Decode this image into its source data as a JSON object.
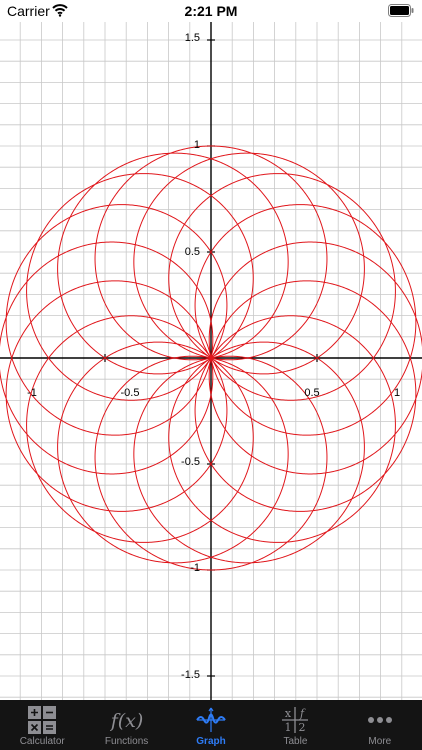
{
  "status_bar": {
    "carrier": "Carrier",
    "time": "2:21 PM"
  },
  "graph": {
    "curve_color": "#e0161b",
    "axis_color": "#000000",
    "grid_color": "#c8c8c8",
    "x_tick_labels": [
      "-1",
      "-0.5",
      "0.5",
      "1"
    ],
    "y_tick_labels": [
      "1.5",
      "1",
      "0.5",
      "-0.5",
      "-1",
      "-1.5"
    ]
  },
  "tabs": [
    {
      "label": "Calculator",
      "icon": "calculator-icon",
      "active": false
    },
    {
      "label": "Functions",
      "icon": "function-icon",
      "active": false
    },
    {
      "label": "Graph",
      "icon": "graph-icon",
      "active": true
    },
    {
      "label": "Table",
      "icon": "table-icon",
      "active": false
    },
    {
      "label": "More",
      "icon": "more-icon",
      "active": false
    }
  ],
  "colors": {
    "tab_bar_background": "#141414",
    "tab_active": "#2e7cf6",
    "tab_inactive": "#8e8e93"
  }
}
